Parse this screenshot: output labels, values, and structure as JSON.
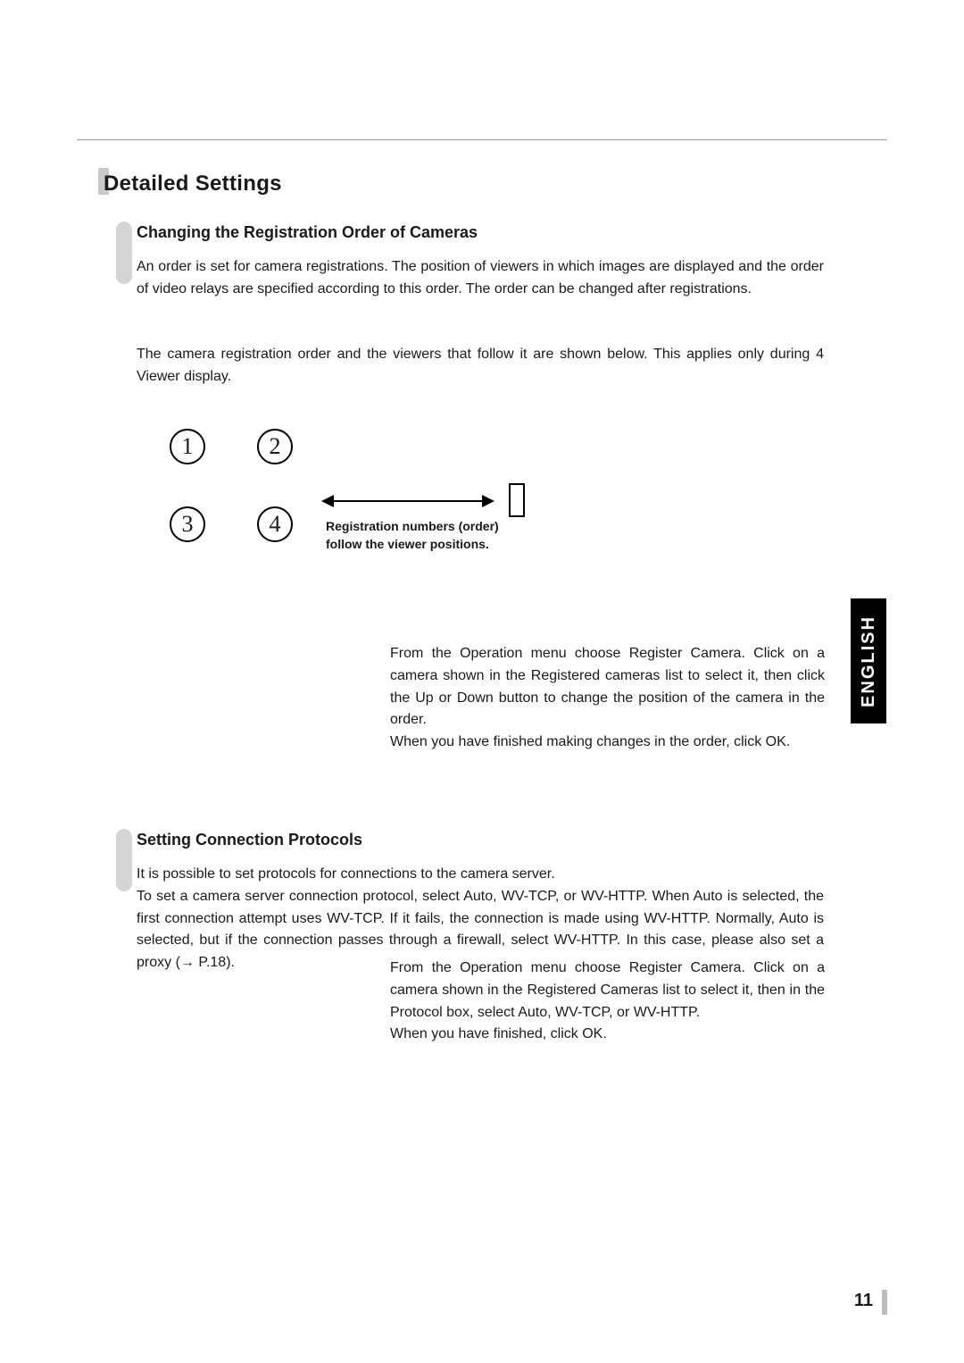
{
  "title": "Detailed Settings",
  "sections": [
    {
      "heading": "Changing the Registration Order of Cameras",
      "paragraphs": [
        "An order is set for camera registrations. The position of viewers in which images are displayed and the order of video relays are specified according to this order. The order can be changed after registrations.",
        "The camera registration order and the viewers that follow it are shown below. This applies only during 4 Viewer display."
      ],
      "diagram": {
        "cells": [
          "1",
          "2",
          "3",
          "4"
        ],
        "arrow_label": "Registration numbers (order) follow the viewer positions."
      },
      "instructions": "From the Operation menu choose Register Camera. Click on a camera shown in the Registered cameras list to select it, then click the Up or Down button to change the position of the camera in the order.\nWhen you have finished making changes in the order, click OK."
    },
    {
      "heading": "Setting Connection Protocols",
      "paragraphs": [
        "It is possible to set protocols for connections to the camera server.\nTo set a camera server connection protocol, select Auto, WV-TCP, or WV-HTTP. When Auto is selected, the first connection attempt uses WV-TCP. If it fails, the connection is made using WV-HTTP. Normally, Auto is selected, but if the connection passes through a firewall, select WV-HTTP. In this case, please also set a proxy (→ P.18)."
      ],
      "instructions": "From the Operation menu choose Register Camera. Click on a camera shown in the Registered Cameras list to select it, then in the Protocol box, select Auto, WV-TCP, or WV-HTTP.\nWhen you have finished, click OK."
    }
  ],
  "language_tab": "ENGLISH",
  "page_number": "11"
}
